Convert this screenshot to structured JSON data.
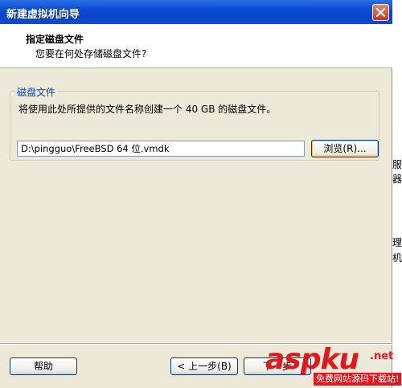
{
  "window": {
    "title": "新建虚拟机向导"
  },
  "header": {
    "title": "指定磁盘文件",
    "subtitle": "您要在何处存储磁盘文件?"
  },
  "disk_group": {
    "legend": "磁盘文件",
    "description": "将使用此处所提供的文件名称创建一个 40 GB 的磁盘文件。",
    "path_value": "D:\\pingguo\\FreeBSD 64 位.vmdk",
    "browse_label": "浏览(R)..."
  },
  "footer": {
    "help_label": "帮助",
    "back_label": "< 上一步(B)",
    "next_label": "下一步"
  },
  "side_fragments": [
    "服",
    "器",
    "理",
    "机"
  ],
  "watermark": {
    "logo": "aspku",
    "suffix": ".net",
    "caption": "免费网站源码下载站!"
  },
  "colors": {
    "titlebar": "#0a45c8",
    "dialog_bg": "#ece9d8",
    "legend_text": "#0046d5",
    "watermark_red": "#e0191e"
  }
}
